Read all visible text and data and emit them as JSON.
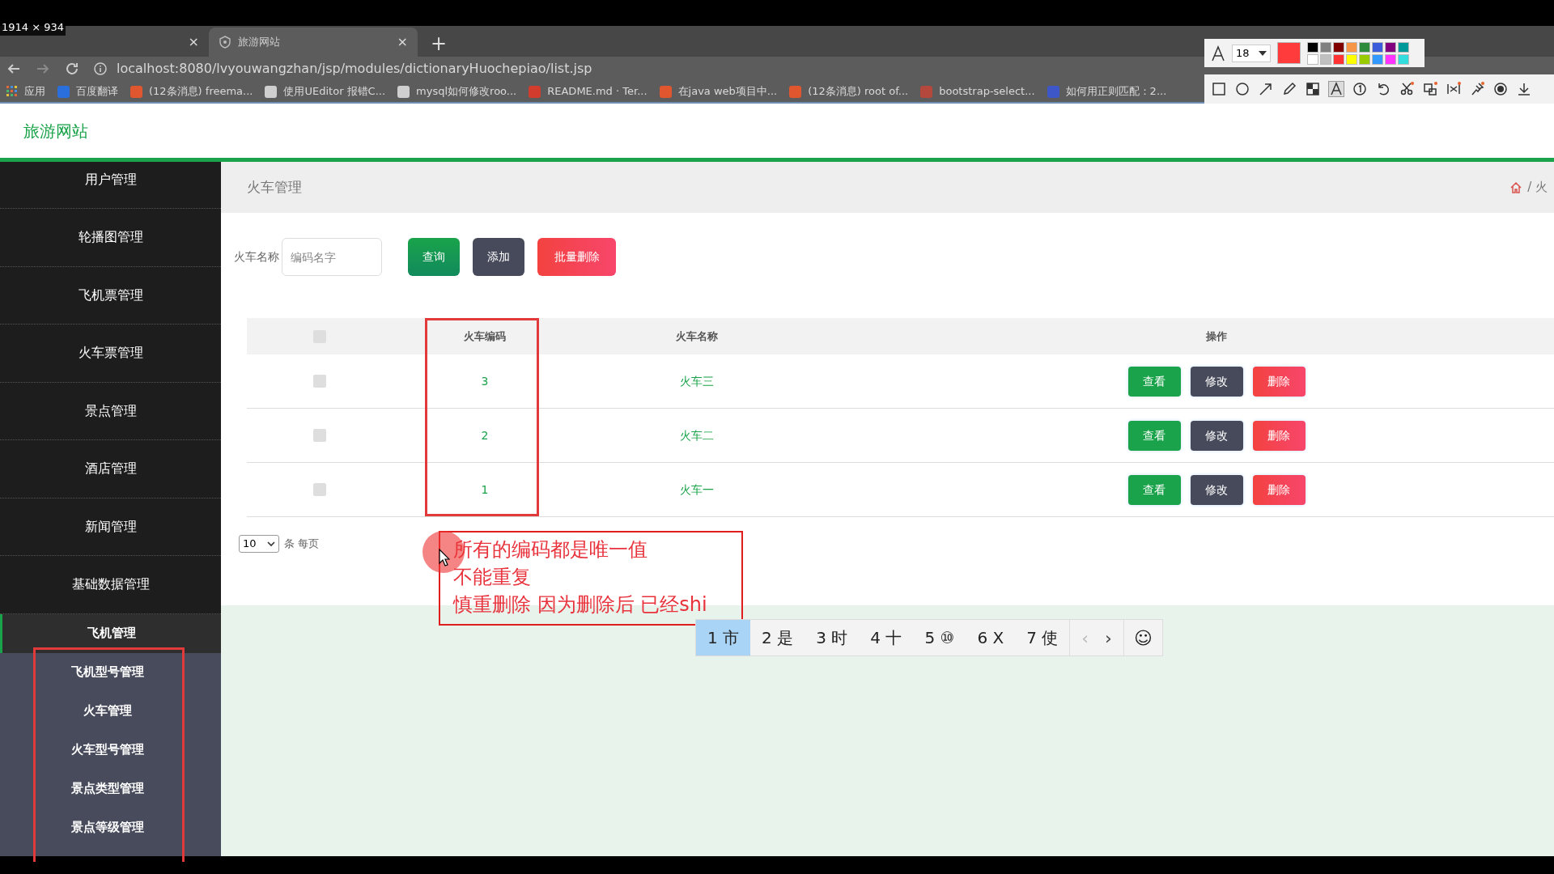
{
  "browser": {
    "tabs": [
      {
        "close": "×",
        "selected": false
      },
      {
        "title": "旅游网站",
        "close": "×",
        "selected": true
      }
    ],
    "new_tab": "+",
    "url": "localhost:8080/lvyouwangzhan/jsp/modules/dictionaryHuochepiao/list.jsp",
    "bookmarks": [
      {
        "kind": "apps",
        "label": "应用"
      },
      {
        "kind": "site",
        "label": "百度翻译",
        "color": "#2a6fdb"
      },
      {
        "kind": "site",
        "label": "(12条消息) freema...",
        "color": "#e0572f"
      },
      {
        "kind": "site",
        "label": "使用UEditor 报错C...",
        "color": "#cfcfcf"
      },
      {
        "kind": "site",
        "label": "mysql如何修改roo...",
        "color": "#cfcfcf"
      },
      {
        "kind": "site",
        "label": "README.md · Ter...",
        "color": "#d23c2c"
      },
      {
        "kind": "site",
        "label": "在java web项目中...",
        "color": "#e0572f"
      },
      {
        "kind": "site",
        "label": "(12条消息) root of...",
        "color": "#e0572f"
      },
      {
        "kind": "site",
        "label": "bootstrap-select...",
        "color": "#b5483c"
      },
      {
        "kind": "site",
        "label": "如何用正则匹配：2...",
        "color": "#3d57c9"
      }
    ]
  },
  "capture_tool": {
    "size_label": "1914 × 934",
    "font_size": "18",
    "palette": [
      {
        "color": "#000000"
      },
      {
        "color": "#808080"
      },
      {
        "color": "#800000"
      },
      {
        "color": "#f79646"
      },
      {
        "color": "#2e8b3c"
      },
      {
        "color": "#3b5bdb"
      },
      {
        "color": "#800080"
      },
      {
        "color": "#009999"
      },
      {
        "color": "#ffffff"
      },
      {
        "color": "#c0c0c0"
      },
      {
        "color": "#ff3333"
      },
      {
        "color": "#ffff00"
      },
      {
        "color": "#99cc00"
      },
      {
        "color": "#3399ff"
      },
      {
        "color": "#ff33ff"
      },
      {
        "color": "#33dddd"
      }
    ]
  },
  "site_title": "旅游网站",
  "sidebar": {
    "items": [
      {
        "label": "用户管理",
        "expanded": false
      },
      {
        "label": "轮播图管理",
        "expanded": false
      },
      {
        "label": "飞机票管理",
        "expanded": false
      },
      {
        "label": "火车票管理",
        "expanded": false
      },
      {
        "label": "景点管理",
        "expanded": false
      },
      {
        "label": "酒店管理",
        "expanded": false
      },
      {
        "label": "新闻管理",
        "expanded": false
      },
      {
        "label": "基础数据管理",
        "expanded": false
      },
      {
        "label": "飞机管理",
        "expanded": true,
        "children": [
          {
            "label": "飞机型号管理"
          },
          {
            "label": "火车管理"
          },
          {
            "label": "火车型号管理"
          },
          {
            "label": "景点类型管理"
          },
          {
            "label": "景点等级管理"
          }
        ]
      }
    ]
  },
  "page_title": "火车管理",
  "breadcrumb": "/ 火",
  "search": {
    "label": "火车名称",
    "placeholder": "编码名字",
    "buttons": [
      {
        "kind": "search",
        "label": "查询"
      },
      {
        "kind": "add",
        "label": "添加"
      },
      {
        "kind": "delete",
        "label": "批量删除"
      }
    ]
  },
  "table": {
    "select_all": {
      "checked": false
    },
    "columns": [
      "火车编码",
      "火车名称",
      "操作"
    ],
    "rows": [
      {
        "checked": false,
        "code": "3",
        "name": "火车三",
        "actions": [
          {
            "kind": "view",
            "label": "查看"
          },
          {
            "kind": "edit",
            "label": "修改"
          },
          {
            "kind": "delete",
            "label": "删除"
          }
        ]
      },
      {
        "checked": false,
        "code": "2",
        "name": "火车二",
        "actions": [
          {
            "kind": "view",
            "label": "查看"
          },
          {
            "kind": "edit",
            "label": "修改"
          },
          {
            "kind": "delete",
            "label": "删除"
          }
        ]
      },
      {
        "checked": false,
        "code": "1",
        "name": "火车一",
        "actions": [
          {
            "kind": "view",
            "label": "查看"
          },
          {
            "kind": "edit",
            "label": "修改"
          },
          {
            "kind": "delete",
            "label": "删除"
          }
        ]
      }
    ]
  },
  "pagination": {
    "page_size": "10",
    "page_size_label": "条 每页"
  },
  "annotation": {
    "lines": [
      "所有的编码都是唯一值",
      "不能重复",
      "慎重删除 因为删除后  已经shi"
    ]
  },
  "ime": {
    "candidates": [
      {
        "label": "1 市",
        "selected": true
      },
      {
        "label": "2 是",
        "selected": false
      },
      {
        "label": "3 时",
        "selected": false
      },
      {
        "label": "4 十",
        "selected": false
      },
      {
        "label": "5 ⑩",
        "selected": false
      },
      {
        "label": "6 X",
        "selected": false
      },
      {
        "label": "7 使",
        "selected": false
      }
    ],
    "prev": "‹",
    "next": "›",
    "emoji": "☺"
  }
}
